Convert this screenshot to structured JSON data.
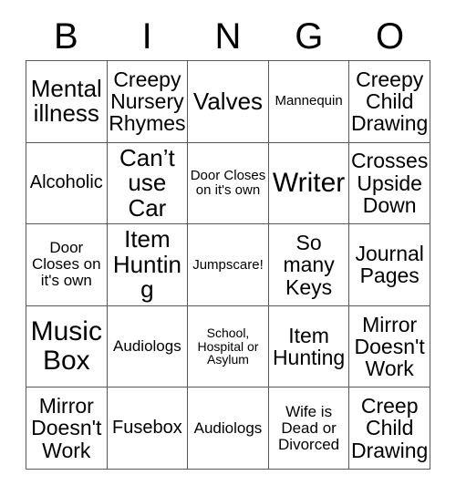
{
  "card": {
    "title": "Bingo Card",
    "header_letters": [
      "B",
      "I",
      "N",
      "G",
      "O"
    ],
    "colors": {
      "background": "#ffffff",
      "grid_line": "#595959",
      "text": "#000000"
    },
    "rows": [
      {
        "cells": [
          {
            "text": "Mental illness",
            "size": "xl"
          },
          {
            "text": "Creepy Nursery Rhymes",
            "size": "lg"
          },
          {
            "text": "Valves",
            "size": "xl"
          },
          {
            "text": "Mannequin",
            "size": "xs"
          },
          {
            "text": "Creepy Child Drawing",
            "size": "lg"
          }
        ]
      },
      {
        "cells": [
          {
            "text": "Alcoholic",
            "size": "md"
          },
          {
            "text": "Can’t use Car",
            "size": "xl"
          },
          {
            "text": "Door Closes on it's own",
            "size": "xs"
          },
          {
            "text": "Writer",
            "size": "xxl"
          },
          {
            "text": "Crosses Upside Down",
            "size": "lg"
          }
        ]
      },
      {
        "cells": [
          {
            "text": "Door Closes on it's own",
            "size": "sm"
          },
          {
            "text": "Item Hunting",
            "size": "xl"
          },
          {
            "text": "Jumpscare!",
            "size": "xs"
          },
          {
            "text": "So many Keys",
            "size": "lg"
          },
          {
            "text": "Journal Pages",
            "size": "lg"
          }
        ]
      },
      {
        "cells": [
          {
            "text": "Music Box",
            "size": "xxl"
          },
          {
            "text": "Audiologs",
            "size": "sm"
          },
          {
            "text": "School, Hospital or Asylum",
            "size": "xxs"
          },
          {
            "text": "Item Hunting",
            "size": "lg"
          },
          {
            "text": "Mirror Doesn't Work",
            "size": "lg"
          }
        ]
      },
      {
        "cells": [
          {
            "text": "Mirror Doesn't Work",
            "size": "lg"
          },
          {
            "text": "Fusebox",
            "size": "md"
          },
          {
            "text": "Audiologs",
            "size": "sm"
          },
          {
            "text": "Wife is Dead or Divorced",
            "size": "sm"
          },
          {
            "text": "Creep Child Drawing",
            "size": "lg"
          }
        ]
      }
    ]
  }
}
